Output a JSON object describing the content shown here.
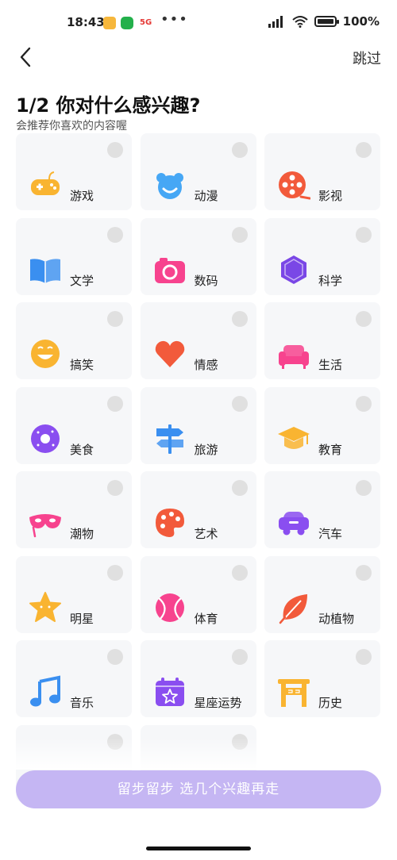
{
  "status_bar": {
    "time": "18:43",
    "network_badge": "5G",
    "overflow": "•••",
    "battery_text": "100%"
  },
  "header": {
    "back_icon": "chevron-left-icon",
    "skip_label": "跳过"
  },
  "page": {
    "title": "1/2 你对什么感兴趣?",
    "subtitle": "会推荐你喜欢的内容喔"
  },
  "interests": [
    {
      "label": "游戏",
      "icon": "gamepad-icon",
      "color": "#f9b431",
      "selected": false
    },
    {
      "label": "动漫",
      "icon": "anime-bear-icon",
      "color": "#46a7f5",
      "selected": false
    },
    {
      "label": "影视",
      "icon": "film-reel-icon",
      "color": "#f25a3b",
      "selected": false
    },
    {
      "label": "文学",
      "icon": "book-icon",
      "color": "#3a8ff0",
      "selected": false
    },
    {
      "label": "数码",
      "icon": "camera-icon",
      "color": "#f7438e",
      "selected": false
    },
    {
      "label": "科学",
      "icon": "hexagon-icon",
      "color": "#7a47e6",
      "selected": false
    },
    {
      "label": "搞笑",
      "icon": "smile-icon",
      "color": "#f9b431",
      "selected": false
    },
    {
      "label": "情感",
      "icon": "heart-icon",
      "color": "#f25a3b",
      "selected": false
    },
    {
      "label": "生活",
      "icon": "sofa-icon",
      "color": "#f7438e",
      "selected": false
    },
    {
      "label": "美食",
      "icon": "donut-icon",
      "color": "#8a4ef0",
      "selected": false
    },
    {
      "label": "旅游",
      "icon": "signpost-icon",
      "color": "#3a8ff0",
      "selected": false
    },
    {
      "label": "教育",
      "icon": "graduation-cap-icon",
      "color": "#f9b431",
      "selected": false
    },
    {
      "label": "潮物",
      "icon": "mask-icon",
      "color": "#f7438e",
      "selected": false
    },
    {
      "label": "艺术",
      "icon": "palette-icon",
      "color": "#f25a3b",
      "selected": false
    },
    {
      "label": "汽车",
      "icon": "car-icon",
      "color": "#8a4ef0",
      "selected": false
    },
    {
      "label": "明星",
      "icon": "star-icon",
      "color": "#f9b431",
      "selected": false
    },
    {
      "label": "体育",
      "icon": "ball-icon",
      "color": "#f7438e",
      "selected": false
    },
    {
      "label": "动植物",
      "icon": "leaf-icon",
      "color": "#f25a3b",
      "selected": false
    },
    {
      "label": "音乐",
      "icon": "music-note-icon",
      "color": "#3a8ff0",
      "selected": false
    },
    {
      "label": "星座运势",
      "icon": "calendar-star-icon",
      "color": "#8a4ef0",
      "selected": false
    },
    {
      "label": "历史",
      "icon": "archway-icon",
      "color": "#f9b431",
      "selected": false
    },
    {
      "label": "",
      "icon": "",
      "color": "#e0e0e0",
      "selected": false
    },
    {
      "label": "",
      "icon": "",
      "color": "#3ab0c0",
      "selected": false
    }
  ],
  "cta": {
    "label": "留步留步 选几个兴趣再走",
    "color": "#c5b6f3"
  }
}
